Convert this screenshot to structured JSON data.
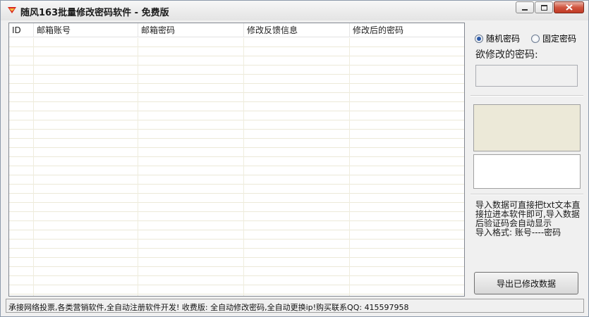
{
  "window": {
    "title": "随风163批量修改密码软件 - 免费版",
    "controls": {
      "minimize": "minimize",
      "maximize": "maximize",
      "close": "close"
    }
  },
  "table": {
    "columns": [
      "ID",
      "邮箱账号",
      "邮箱密码",
      "修改反馈信息",
      "修改后的密码"
    ],
    "rows": []
  },
  "options": {
    "random_label": "随机密码",
    "fixed_label": "固定密码",
    "selected": "随机密码"
  },
  "password": {
    "label": "欲修改的密码:",
    "value": ""
  },
  "captcha": {
    "input_value": ""
  },
  "info": {
    "text": "导入数据可直接把txt文本直接拉进本软件即可,导入数据后验证码会自动显示\n导入格式: 账号----密码"
  },
  "buttons": {
    "export": "导出已修改数据"
  },
  "status": {
    "text": "承接网络投票,各类营销软件,全自动注册软件开发! 收费版: 全自动修改密码,全自动更换ip!购买联系QQ: 415597958"
  },
  "colors": {
    "window_bg": "#f0f0f0",
    "grid_line": "#ece9d8",
    "close_button": "#c13a25",
    "radio_dot": "#2c5aa8"
  },
  "icons": {
    "app": "app-logo-icon",
    "minimize": "minimize-icon",
    "maximize": "maximize-icon",
    "close": "close-icon"
  }
}
